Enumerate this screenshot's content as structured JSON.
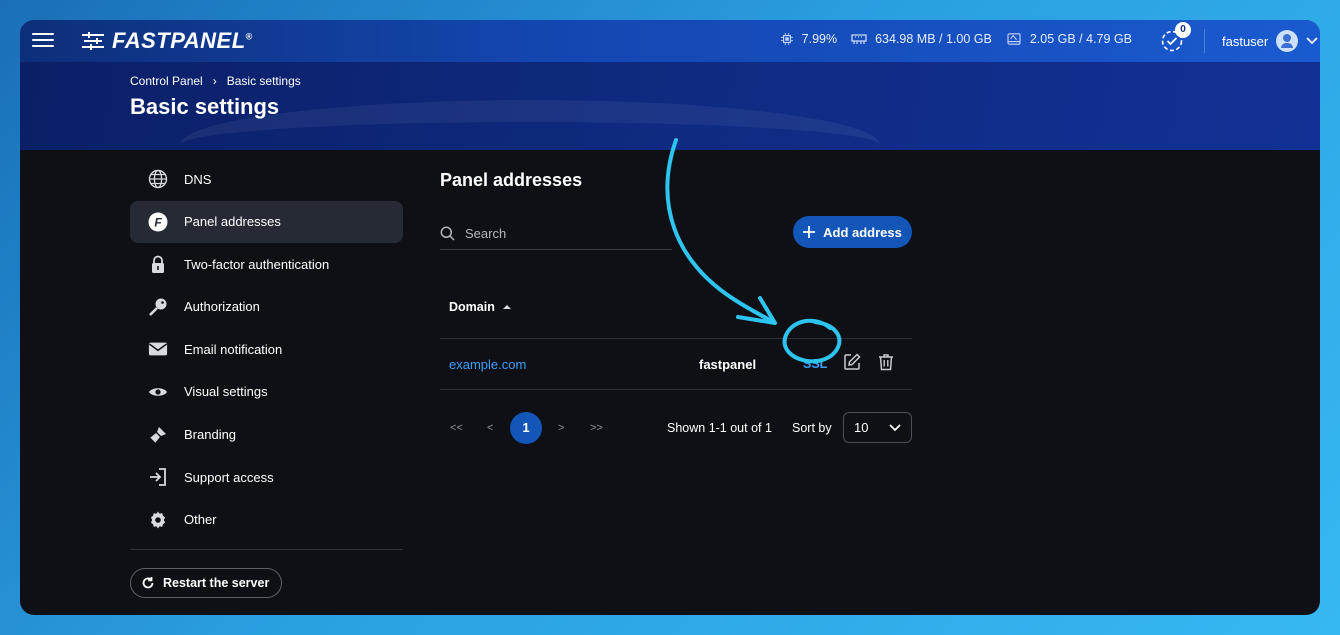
{
  "topbar": {
    "logo": "FASTPANEL",
    "logo_mark": "®",
    "stats": {
      "cpu": "7.99%",
      "memory": "634.98 MB / 1.00 GB",
      "disk": "2.05 GB / 4.79 GB"
    },
    "tasks_count": "0",
    "username": "fastuser"
  },
  "header": {
    "breadcrumb": [
      "Control Panel",
      "Basic settings"
    ],
    "title": "Basic settings"
  },
  "sidebar": {
    "items": [
      {
        "label": "DNS",
        "icon": "globe-icon"
      },
      {
        "label": "Panel addresses",
        "icon": "fastpanel-f-icon",
        "active": true
      },
      {
        "label": "Two-factor authentication",
        "icon": "lock-icon"
      },
      {
        "label": "Authorization",
        "icon": "key-icon"
      },
      {
        "label": "Email notification",
        "icon": "envelope-icon"
      },
      {
        "label": "Visual settings",
        "icon": "eye-icon"
      },
      {
        "label": "Branding",
        "icon": "brush-icon"
      },
      {
        "label": "Support access",
        "icon": "sign-in-icon"
      },
      {
        "label": "Other",
        "icon": "gear-icon"
      }
    ],
    "restart_label": "Restart the server"
  },
  "main": {
    "section_title": "Panel addresses",
    "search_placeholder": "Search",
    "add_button": "Add address",
    "table": {
      "columns": [
        "Domain"
      ],
      "rows": [
        {
          "domain": "example.com",
          "owner": "fastpanel",
          "ssl": "SSL"
        }
      ]
    },
    "pagination": {
      "first": "<<",
      "prev": "<",
      "current": "1",
      "next": ">",
      "last": ">>",
      "shown_text": "Shown 1-1 out of 1",
      "sort_label": "Sort by",
      "page_size": "10"
    }
  },
  "colors": {
    "accent": "#1455b8",
    "link": "#3aa0ff",
    "annotation": "#2ec4f0"
  }
}
